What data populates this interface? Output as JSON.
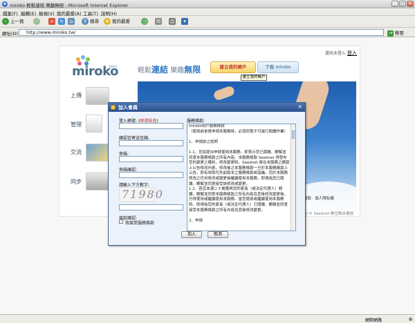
{
  "window": {
    "title": "miroko 輕鬆連結 樂趣無限 - Microsoft Internet Explorer"
  },
  "menu": [
    "檔案(F)",
    "編輯(E)",
    "檢視(V)",
    "我的最愛(A)",
    "工具(T)",
    "說明(H)"
  ],
  "toolbar": {
    "back": "上一頁",
    "search": "搜尋",
    "favorites": "我的最愛"
  },
  "address": {
    "label": "網址(D)",
    "url": "http://www.miroko.tw/",
    "go": "移至"
  },
  "site": {
    "logo": "miroko",
    "beta": "beta",
    "nav": [
      "上傳",
      "管理",
      "交流",
      "同步"
    ],
    "slogan_pre": "輕鬆",
    "slogan_b1": "連結",
    "slogan_mid": "樂趣",
    "slogan_b2": "無限",
    "register": "建立我的帳戶",
    "download": "下載 miroko",
    "tooltip": "建立我的帳戶",
    "login_prompt": "還尚未登入",
    "login": "登入",
    "links": "服務條款 · 個人隱私權",
    "copyright": "ight © Seednet 數位聯合電信"
  },
  "dialog": {
    "title": "加入會員",
    "login_label": "登入帳號:",
    "check_link": "帳號檢查",
    "email_label": "確認信寄送信箱:",
    "password_label": "密碼:",
    "confirm_label": "密碼確認:",
    "captcha_label": "請輸入下方數字:",
    "captcha": "71980",
    "agree_label": "條款確認:",
    "agree_text": "我接受服務條款",
    "terms_label": "服務條款:",
    "terms_text": "miroko用戶服務條款\n（使用前會員申請本服務時，必須同意才可進行閱讀作業）\n\n1、申請前之說明\n\n1.1、您如提出申請使用本服務，即表示您已閱讀、瞭解並同意本服務條款之所有內容。本服務條款 Seednet 得發布您的變更之權利，修改變更時，Seednet 將在本服務之網頁上公告修改內容，修改後之本服務條款一旦於本服務網頁上公告，即有效取代先前版本之服務條款或協議。您於本服務修改之任何修改或變更後繼續使用本服務，即視為您已閱讀、瞭解並同意接受該修改或變更。\n1.2、若您未滿二十歲應與您的家長（或法定代理人）閱讀、瞭解並同意本服務條款之所有內容及其後修改變更後，方得使用或繼續使用本服務。當您使用或繼續使用本服務時，即視為您的家長（或法定代理人）已閱讀、瞭解並同意接受本服務條款之所有內容及其後修改變更。\n\n2、申請",
    "submit": "加入",
    "cancel": "取消"
  },
  "status": {
    "zone": "網際網路"
  },
  "colors": {
    "accent": "#2e7ac4",
    "dialog_title": "#284f8b",
    "register": "#f7d36a"
  }
}
